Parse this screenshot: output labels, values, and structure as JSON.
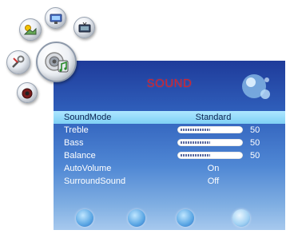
{
  "menu": {
    "title": "SOUND",
    "items": [
      {
        "label": "SoundMode",
        "value": "Standard",
        "selected": true
      },
      {
        "label": "Treble",
        "level": 50,
        "max": 100
      },
      {
        "label": "Bass",
        "level": 50,
        "max": 100
      },
      {
        "label": "Balance",
        "level": 50,
        "max": 100
      },
      {
        "label": "AutoVolume",
        "value": "On"
      },
      {
        "label": "SurroundSound",
        "value": "Off"
      }
    ]
  },
  "icons": [
    "picture-icon",
    "setup-icon",
    "channel-icon",
    "option-icon",
    "sound-icon",
    "lock-icon"
  ],
  "colors": {
    "title": "#d6222a",
    "highlight": "#9fdcf8",
    "panel_top": "#1f3b9a",
    "panel_bottom": "#a7c9ee"
  }
}
